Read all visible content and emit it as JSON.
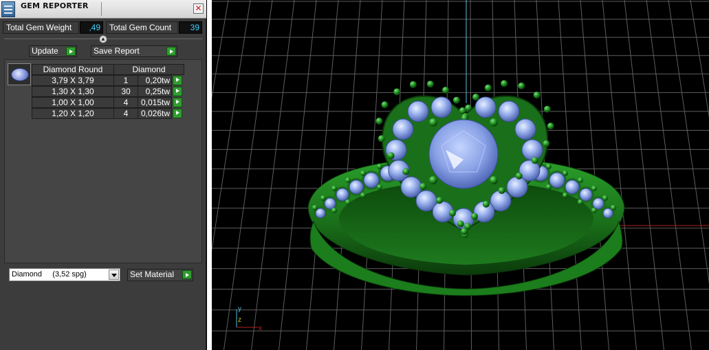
{
  "window": {
    "title": "GEM REPORTER",
    "close_label": "✕"
  },
  "summary": {
    "weight_label": "Total Gem Weight",
    "weight_value": ",49",
    "count_label": "Total Gem Count",
    "count_value": "39"
  },
  "toolbar": {
    "update_label": "Update",
    "save_report_label": "Save Report"
  },
  "gem_table": {
    "headers": [
      "Diamond Round",
      "Diamond"
    ],
    "rows": [
      {
        "size": "3,79 X 3,79",
        "count": "1",
        "weight": "0,20tw"
      },
      {
        "size": "1,30 X 1,30",
        "count": "30",
        "weight": "0,25tw"
      },
      {
        "size": "1,00 X 1,00",
        "count": "4",
        "weight": "0,015tw"
      },
      {
        "size": "1,20 X 1,20",
        "count": "4",
        "weight": "0,026tw"
      }
    ]
  },
  "material": {
    "selected": "Diamond     (3,52 spg)",
    "set_label": "Set Material"
  },
  "axes": {
    "y": "y",
    "z": "z",
    "x": "x"
  },
  "icons": {
    "app": "gem-reporter-icon",
    "close": "close-icon",
    "collapse": "collapse-arrow-icon",
    "run": "green-play-arrow-icon",
    "dropdown": "chevron-down-icon",
    "gem": "round-diamond-icon"
  },
  "colors": {
    "metal": "#1f7f1f",
    "stone": "#8fa8e8",
    "grid": "#5e5e5e",
    "axis_y": "#58c0d8",
    "axis_x": "#b02020",
    "value_text": "#3fd0ff"
  }
}
